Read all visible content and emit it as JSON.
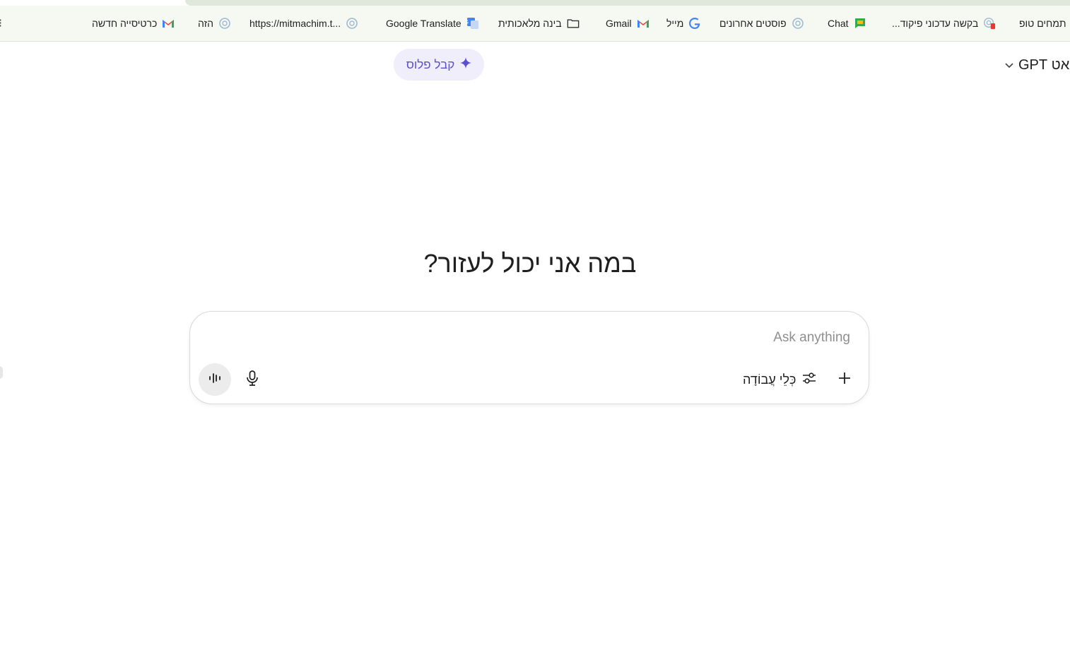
{
  "bookmarks": {
    "overflow_label": "⁝",
    "items": [
      {
        "label": "כרטיסייה חדשה",
        "icon": "gmail-icon"
      },
      {
        "label": "הזה",
        "icon": "openai-icon"
      },
      {
        "label": "https://mitmachim.t...",
        "icon": "openai-icon"
      },
      {
        "label": "Google Translate",
        "icon": "google-translate-icon"
      },
      {
        "label": "בינה מלאכותית",
        "icon": "folder-icon"
      },
      {
        "label": "Gmail",
        "icon": "gmail-icon"
      },
      {
        "label": "מייל",
        "icon": "google-icon"
      },
      {
        "label": "פוסטים אחרונים",
        "icon": "openai-icon"
      },
      {
        "label": "Chat",
        "icon": "google-chat-icon"
      },
      {
        "label": "בקשה עדכוני פיקוד...",
        "icon": "openai-alert-icon"
      },
      {
        "label": "תמחים טופ",
        "icon": "none"
      }
    ]
  },
  "header": {
    "model_label": "צ'אט GPT",
    "upgrade_label": "קבל פלוס"
  },
  "main": {
    "heading": "במה אני יכול לעזור?",
    "composer": {
      "placeholder": "Ask anything",
      "tools_label": "כְּלֵי עֲבוֹדָה"
    }
  },
  "colors": {
    "accent": "#5b4fcf",
    "upgrade_bg": "#efeefa",
    "bookmarks_bg": "#f5f9f1"
  }
}
